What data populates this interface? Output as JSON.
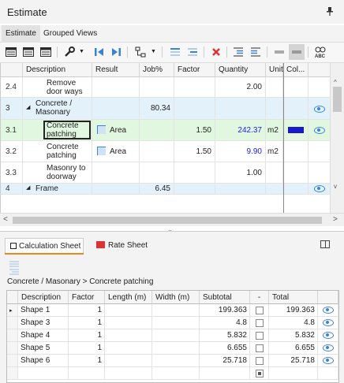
{
  "window": {
    "title": "Estimate",
    "pin_icon": "pin-icon"
  },
  "tabs": [
    {
      "label": "Estimate",
      "active": true
    },
    {
      "label": "Grouped Views",
      "active": false
    }
  ],
  "toolbar": {
    "icons": [
      "grid-view-icon",
      "grid-view-2-icon",
      "grid-view-3-icon",
      "tools-icon",
      "arrow-left-icon",
      "arrow-right-icon",
      "hierarchy-icon",
      "insert-row-icon",
      "insert-child-icon",
      "delete-icon",
      "indent-icon",
      "outdent-icon",
      "collapse-icon",
      "expand-icon",
      "spellcheck-icon"
    ]
  },
  "grid": {
    "headers": [
      "Description",
      "Result",
      "Job%",
      "Factor",
      "Quantity",
      "Unit",
      "Col..."
    ],
    "rows": [
      {
        "num": "2.4",
        "description": "Remove door ways",
        "result": "",
        "job": "",
        "factor": "",
        "quantity": "2.00",
        "unit": "",
        "color": "",
        "eye": false,
        "type": "item"
      },
      {
        "num": "3",
        "description": "Concrete / Masonary",
        "result": "",
        "job": "80.34",
        "factor": "",
        "quantity": "",
        "unit": "",
        "color": "",
        "eye": true,
        "type": "group"
      },
      {
        "num": "3.1",
        "description": "Concrete patching",
        "result": "Area",
        "job": "",
        "factor": "1.50",
        "quantity": "242.37",
        "unit": "m2",
        "color": "#1a1acd",
        "eye": true,
        "type": "selected"
      },
      {
        "num": "3.2",
        "description": "Concrete patching",
        "result": "Area",
        "job": "",
        "factor": "1.50",
        "quantity": "9.90",
        "unit": "m2",
        "color": "",
        "eye": false,
        "type": "item"
      },
      {
        "num": "3.3",
        "description": "Masonry to doorway",
        "result": "",
        "job": "",
        "factor": "",
        "quantity": "1.00",
        "unit": "",
        "color": "",
        "eye": false,
        "type": "item"
      },
      {
        "num": "4",
        "description": "Frame",
        "result": "",
        "job": "6.45",
        "factor": "",
        "quantity": "",
        "unit": "",
        "color": "",
        "eye": true,
        "type": "group"
      }
    ]
  },
  "lower_panel": {
    "tabs": [
      {
        "label": "Calculation Sheet",
        "active": true
      },
      {
        "label": "Rate Sheet",
        "active": false
      }
    ],
    "breadcrumb": "Concrete / Masonary > Concrete patching",
    "headers": [
      "Description",
      "Factor",
      "Length (m)",
      "Width (m)",
      "Subtotal",
      "-",
      "Total"
    ],
    "rows": [
      {
        "description": "Shape 1",
        "factor": "1",
        "length": "",
        "width": "",
        "subtotal": "199.363",
        "total": "199.363"
      },
      {
        "description": "Shape 3",
        "factor": "1",
        "length": "",
        "width": "",
        "subtotal": "4.8",
        "total": "4.8"
      },
      {
        "description": "Shape 4",
        "factor": "1",
        "length": "",
        "width": "",
        "subtotal": "5.832",
        "total": "5.832"
      },
      {
        "description": "Shape 5",
        "factor": "1",
        "length": "",
        "width": "",
        "subtotal": "6.655",
        "total": "6.655"
      },
      {
        "description": "Shape 6",
        "factor": "1",
        "length": "",
        "width": "",
        "subtotal": "25.718",
        "total": "25.718"
      }
    ]
  }
}
